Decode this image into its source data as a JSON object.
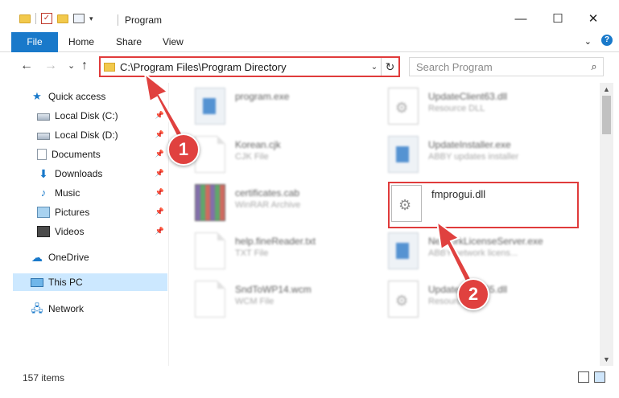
{
  "window": {
    "title": "Program",
    "minimize": "—",
    "maximize": "☐",
    "close": "✕"
  },
  "ribbon": {
    "tabs": [
      "File",
      "Home",
      "Share",
      "View"
    ]
  },
  "nav": {
    "back": "←",
    "forward": "→",
    "recent": "⌄",
    "up": "↑",
    "address": "C:\\Program Files\\Program Directory",
    "refresh": "↻",
    "search_placeholder": "Search Program"
  },
  "sidebar": {
    "items": [
      {
        "label": "Quick access"
      },
      {
        "label": "Local Disk (C:)"
      },
      {
        "label": "Local Disk (D:)"
      },
      {
        "label": "Documents"
      },
      {
        "label": "Downloads"
      },
      {
        "label": "Music"
      },
      {
        "label": "Pictures"
      },
      {
        "label": "Videos"
      },
      {
        "label": "OneDrive"
      },
      {
        "label": "This PC"
      },
      {
        "label": "Network"
      }
    ]
  },
  "files": [
    {
      "name": "program.exe",
      "type": "",
      "icon": "app-icon"
    },
    {
      "name": "UpdateClient63.dll",
      "type": "Resource DLL",
      "icon": "gear-file-icon"
    },
    {
      "name": "Korean.cjk",
      "type": "CJK File",
      "icon": "generic-file-icon"
    },
    {
      "name": "UpdateInstaller.exe",
      "type": "ABBY updates installer",
      "icon": "app-icon"
    },
    {
      "name": "certificates.cab",
      "type": "WinRAR Archive",
      "icon": "archive-icon"
    },
    {
      "name": "fmprogui.dll",
      "type": "",
      "icon": "gear-file-icon"
    },
    {
      "name": "help.fineReader.txt",
      "type": "TXT File",
      "icon": "generic-file-icon"
    },
    {
      "name": "NetworkLicenseServer.exe",
      "type": "ABBY network licens...",
      "icon": "app-icon"
    },
    {
      "name": "SndToWP14.wcm",
      "type": "WCM File",
      "icon": "generic-file-icon"
    },
    {
      "name": "UpdateClient65.dll",
      "type": "Resource DLL",
      "icon": "gear-file-icon"
    }
  ],
  "status": {
    "item_count": "157 items"
  },
  "annotations": {
    "step1": "1",
    "step2": "2",
    "color": "#e03b3b"
  }
}
